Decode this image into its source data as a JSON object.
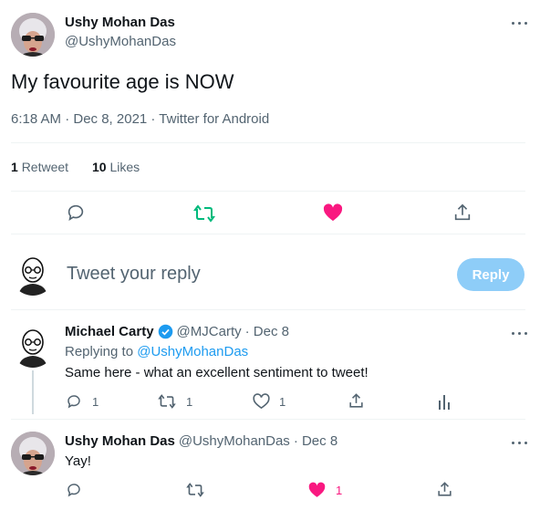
{
  "main_tweet": {
    "author_name": "Ushy Mohan Das",
    "author_handle": "@UshyMohanDas",
    "text": "My favourite age is NOW",
    "meta": "6:18 AM · Dec 8, 2021 · Twitter for Android",
    "retweet_count": "1",
    "retweet_label": "Retweet",
    "like_count": "10",
    "like_label": "Likes"
  },
  "composer": {
    "placeholder": "Tweet your reply",
    "button_label": "Reply"
  },
  "replies": [
    {
      "author_name": "Michael Carty",
      "author_handle": "@MJCarty",
      "date": "· Dec 8",
      "replying_to_prefix": "Replying to ",
      "replying_to_handle": "@UshyMohanDas",
      "text": "Same here - what an excellent sentiment to tweet!",
      "reply_count": "1",
      "retweet_count": "1",
      "like_count": "1"
    },
    {
      "author_name": "Ushy Mohan Das",
      "author_handle": "@UshyMohanDas",
      "date": "· Dec 8",
      "text": "Yay!",
      "like_count": "1"
    }
  ],
  "colors": {
    "retweet_green": "#00ba7c",
    "like_pink": "#f91880",
    "link_blue": "#1d9bf0",
    "verified_blue": "#1d9bf0",
    "reply_button_disabled": "#8ecdf8"
  }
}
